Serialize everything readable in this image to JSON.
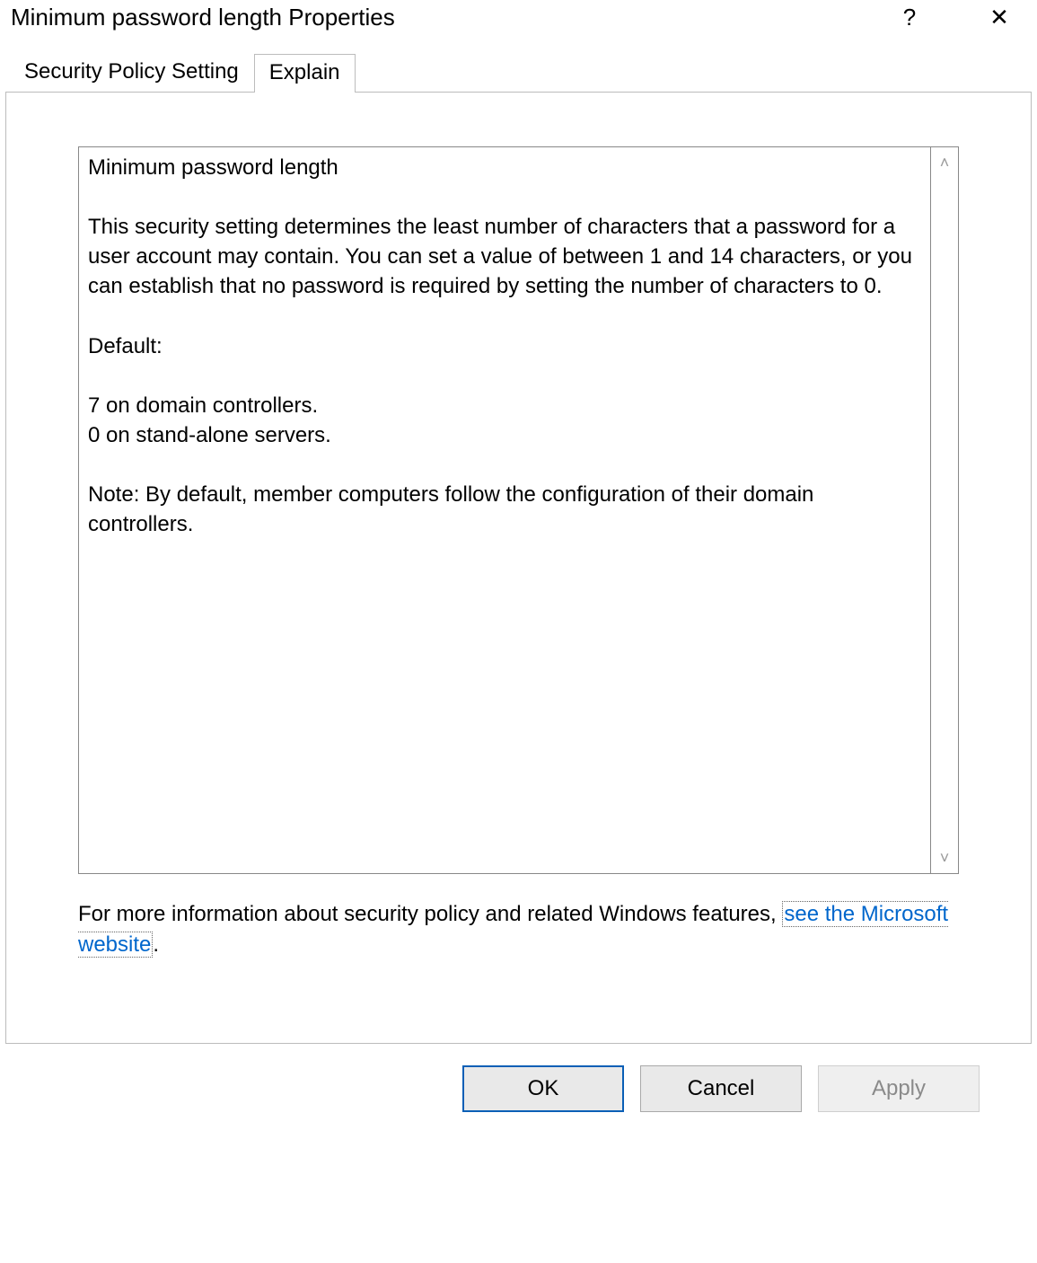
{
  "window": {
    "title": "Minimum password length Properties"
  },
  "tabs": {
    "security": "Security Policy Setting",
    "explain": "Explain"
  },
  "explain": {
    "text": "Minimum password length\n\nThis security setting determines the least number of characters that a password for a user account may contain. You can set a value of between 1 and 14 characters, or you can establish that no password is required by setting the number of characters to 0.\n\nDefault:\n\n7 on domain controllers.\n0 on stand-alone servers.\n\nNote: By default, member computers follow the configuration of their domain controllers."
  },
  "more_info": {
    "prefix": "For more information about security policy and related Windows features, ",
    "link": "see the Microsoft website",
    "suffix": "."
  },
  "buttons": {
    "ok": "OK",
    "cancel": "Cancel",
    "apply": "Apply"
  },
  "icons": {
    "help": "?",
    "close": "✕",
    "scroll_up": "˄",
    "scroll_down": "˅"
  }
}
